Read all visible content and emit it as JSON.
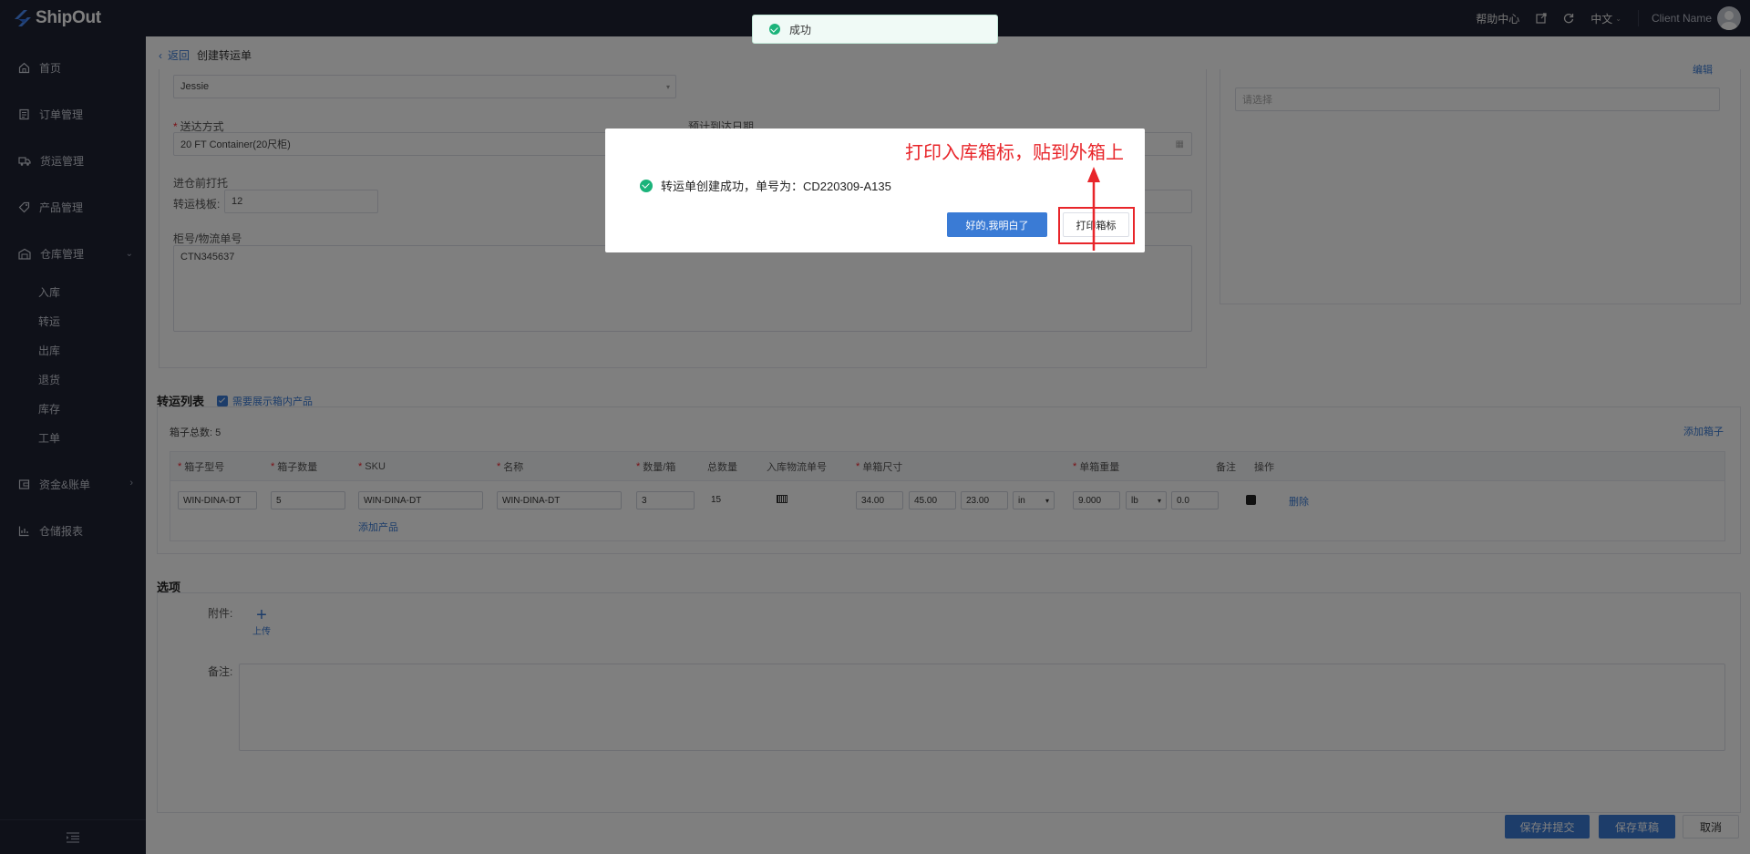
{
  "topbar": {
    "brand": "ShipOut",
    "help": "帮助中心",
    "language": "中文",
    "client_name": "Client Name"
  },
  "sidebar": {
    "items": [
      {
        "label": "首页",
        "icon": "home-icon"
      },
      {
        "label": "订单管理",
        "icon": "order-icon"
      },
      {
        "label": "货运管理",
        "icon": "truck-icon"
      },
      {
        "label": "产品管理",
        "icon": "tag-icon"
      },
      {
        "label": "仓库管理",
        "icon": "warehouse-icon"
      }
    ],
    "warehouse_sub": [
      "入库",
      "转运",
      "出库",
      "退货",
      "库存",
      "工单"
    ],
    "finance": "资金&账单",
    "report": "仓储报表"
  },
  "breadcrumb": {
    "back": "返回",
    "current": "创建转运单"
  },
  "form": {
    "contact_value": "Jessie",
    "delivery_method_label": "送达方式",
    "delivery_method_value": "20 FT Container(20尺柜)",
    "eta_label": "预计到达日期",
    "pallet_section_label": "进仓前打托",
    "pallet_qty_label": "转运栈板:",
    "pallet_qty_value": "12",
    "tracking_label": "柜号/物流单号",
    "tracking_value": "CTN345637",
    "right_select_placeholder": "请选择",
    "right_top_link": "编辑"
  },
  "transfer_list": {
    "title": "转运列表",
    "show_products_label": "需要展示箱内产品",
    "box_total": "箱子总数: 5",
    "add_box": "添加箱子",
    "headers": [
      "箱子型号",
      "箱子数量",
      "SKU",
      "名称",
      "数量/箱",
      "总数量",
      "入库物流单号",
      "单箱尺寸",
      "单箱重量",
      "备注",
      "操作"
    ],
    "required": [
      true,
      true,
      true,
      true,
      true,
      false,
      false,
      true,
      true,
      false,
      false
    ],
    "row": {
      "box_model": "WIN-DINA-DT",
      "box_qty": "5",
      "sku": "WIN-DINA-DT",
      "name": "WIN-DINA-DT",
      "qty_per_box": "3",
      "total_qty": "15",
      "dim_l": "34.00",
      "dim_w": "45.00",
      "dim_h": "23.00",
      "dim_unit": "in",
      "weight": "9.000",
      "weight_unit": "lb",
      "weight_extra": "0.0",
      "delete": "删除"
    },
    "add_product": "添加产品"
  },
  "options": {
    "title": "选项",
    "attachment_label": "附件:",
    "upload": "上传",
    "remark_label": "备注:"
  },
  "footer": {
    "submit": "保存并提交",
    "draft": "保存草稿",
    "cancel": "取消"
  },
  "toast": {
    "text": "成功"
  },
  "dialog": {
    "message": "转运单创建成功，单号为：CD220309-A135",
    "ok_button": "好的,我明白了",
    "print_button": "打印箱标"
  },
  "annotation": {
    "text": "打印入库箱标，贴到外箱上",
    "color": "#e8252a"
  },
  "colors": {
    "primary": "#3a7bd5",
    "sidebar": "#1f2233",
    "success": "#1bb37a"
  }
}
